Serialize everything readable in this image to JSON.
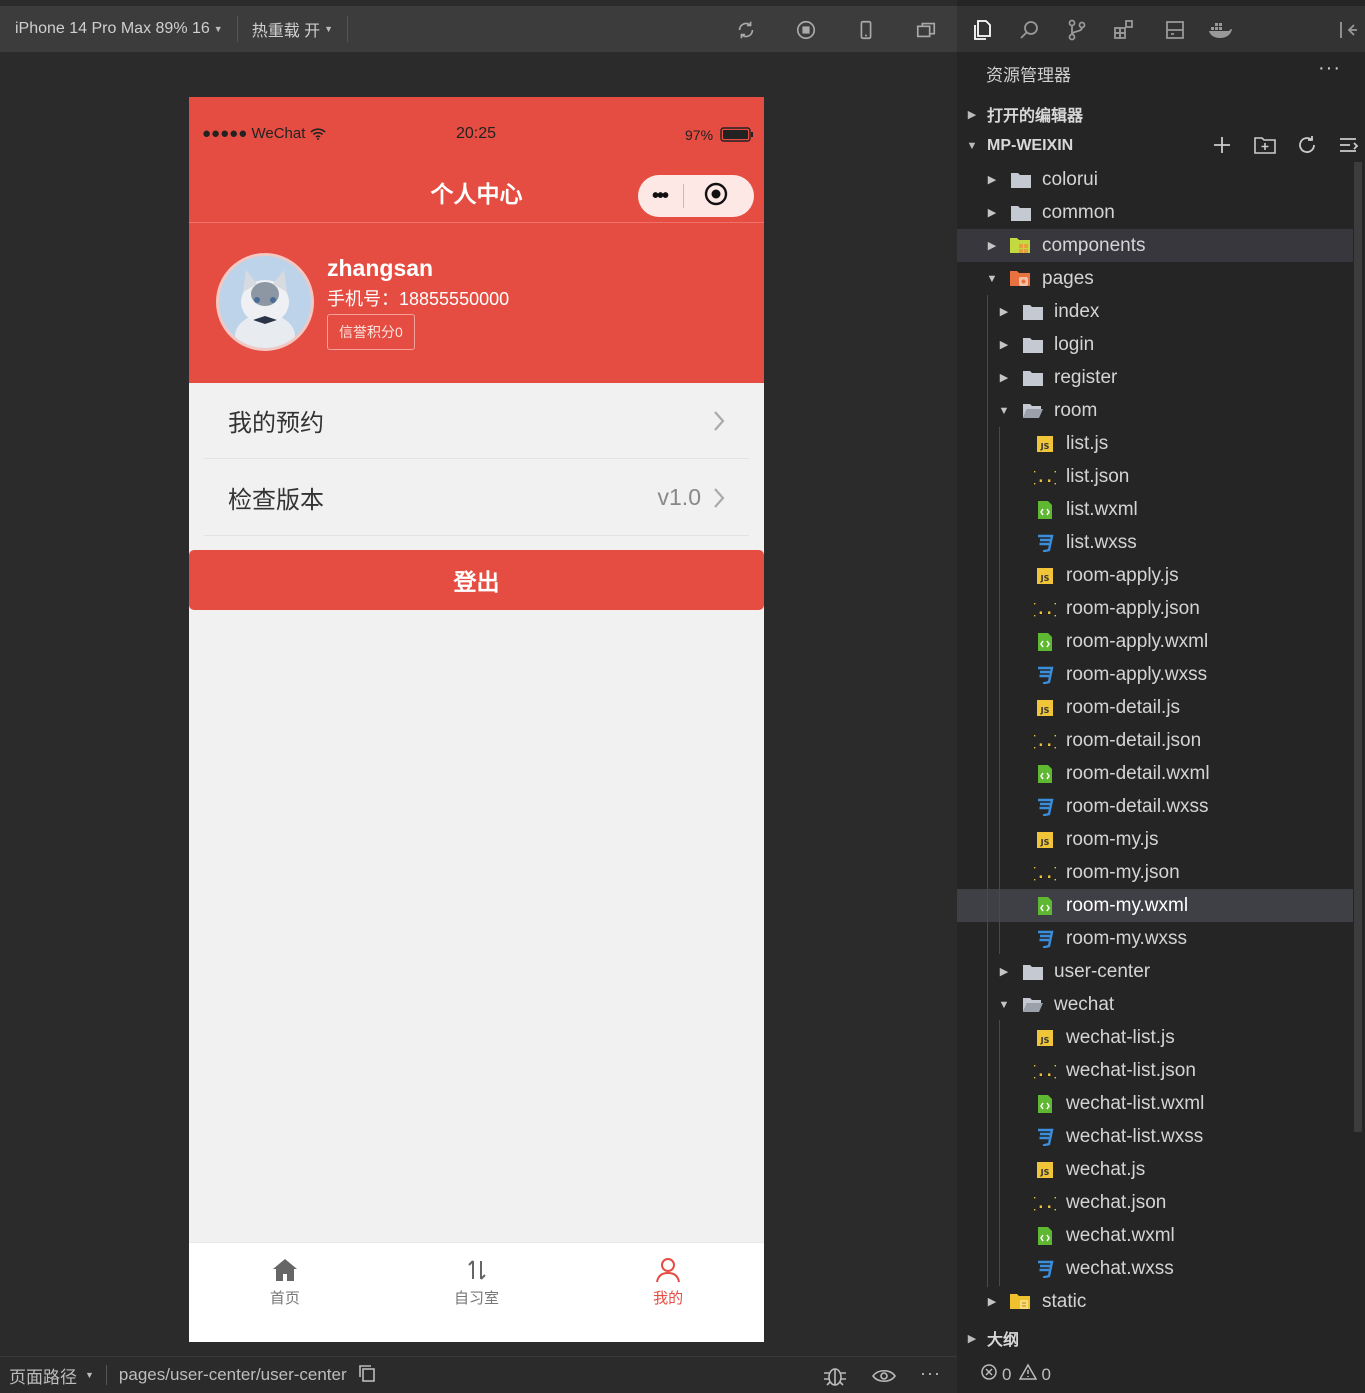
{
  "toolbar": {
    "device": "iPhone 14 Pro Max 89% 16",
    "hot_reload": "热重载 开"
  },
  "phone": {
    "status": {
      "carrier": "●●●●● WeChat",
      "time": "20:25",
      "battery": "97%"
    },
    "nav_title": "个人中心",
    "user": {
      "name": "zhangsan",
      "phone": "手机号：18855550000",
      "credit": "信誉积分0"
    },
    "menu": [
      {
        "label": "我的预约",
        "value": ""
      },
      {
        "label": "检查版本",
        "value": "v1.0"
      }
    ],
    "logout_label": "登出",
    "tabs": [
      {
        "label": "首页",
        "icon": "home-icon",
        "active": false
      },
      {
        "label": "自习室",
        "icon": "sort-arrows-icon",
        "active": false
      },
      {
        "label": "我的",
        "icon": "user-icon",
        "active": true
      }
    ],
    "accent_color": "#e54d42"
  },
  "explorer": {
    "title": "资源管理器",
    "more": "···",
    "open_editors": "打开的编辑器",
    "project": "MP-WEIXIN",
    "outline": "大纲",
    "tree": [
      {
        "name": "colorui",
        "type": "folder",
        "open": false,
        "depth": 1
      },
      {
        "name": "common",
        "type": "folder",
        "open": false,
        "depth": 1
      },
      {
        "name": "components",
        "type": "folder-components",
        "open": false,
        "depth": 1
      },
      {
        "name": "pages",
        "type": "folder-pages",
        "open": true,
        "depth": 1
      },
      {
        "name": "index",
        "type": "folder",
        "open": false,
        "depth": 2
      },
      {
        "name": "login",
        "type": "folder",
        "open": false,
        "depth": 2
      },
      {
        "name": "register",
        "type": "folder",
        "open": false,
        "depth": 2
      },
      {
        "name": "room",
        "type": "folder",
        "open": true,
        "depth": 2
      },
      {
        "name": "list.js",
        "type": "js",
        "depth": 3
      },
      {
        "name": "list.json",
        "type": "json",
        "depth": 3
      },
      {
        "name": "list.wxml",
        "type": "wxml",
        "depth": 3
      },
      {
        "name": "list.wxss",
        "type": "wxss",
        "depth": 3
      },
      {
        "name": "room-apply.js",
        "type": "js",
        "depth": 3
      },
      {
        "name": "room-apply.json",
        "type": "json",
        "depth": 3
      },
      {
        "name": "room-apply.wxml",
        "type": "wxml",
        "depth": 3
      },
      {
        "name": "room-apply.wxss",
        "type": "wxss",
        "depth": 3
      },
      {
        "name": "room-detail.js",
        "type": "js",
        "depth": 3
      },
      {
        "name": "room-detail.json",
        "type": "json",
        "depth": 3
      },
      {
        "name": "room-detail.wxml",
        "type": "wxml",
        "depth": 3
      },
      {
        "name": "room-detail.wxss",
        "type": "wxss",
        "depth": 3
      },
      {
        "name": "room-my.js",
        "type": "js",
        "depth": 3
      },
      {
        "name": "room-my.json",
        "type": "json",
        "depth": 3
      },
      {
        "name": "room-my.wxml",
        "type": "wxml",
        "depth": 3,
        "selected": true
      },
      {
        "name": "room-my.wxss",
        "type": "wxss",
        "depth": 3
      },
      {
        "name": "user-center",
        "type": "folder",
        "open": false,
        "depth": 2
      },
      {
        "name": "wechat",
        "type": "folder",
        "open": true,
        "depth": 2
      },
      {
        "name": "wechat-list.js",
        "type": "js",
        "depth": 3
      },
      {
        "name": "wechat-list.json",
        "type": "json",
        "depth": 3
      },
      {
        "name": "wechat-list.wxml",
        "type": "wxml",
        "depth": 3
      },
      {
        "name": "wechat-list.wxss",
        "type": "wxss",
        "depth": 3
      },
      {
        "name": "wechat.js",
        "type": "js",
        "depth": 3
      },
      {
        "name": "wechat.json",
        "type": "json",
        "depth": 3
      },
      {
        "name": "wechat.wxml",
        "type": "wxml",
        "depth": 3
      },
      {
        "name": "wechat.wxss",
        "type": "wxss",
        "depth": 3
      },
      {
        "name": "static",
        "type": "folder-static",
        "open": false,
        "depth": 1
      }
    ]
  },
  "bottom": {
    "page_path_label": "页面路径",
    "page_path": "pages/user-center/user-center",
    "errors": "0",
    "warnings": "0"
  }
}
